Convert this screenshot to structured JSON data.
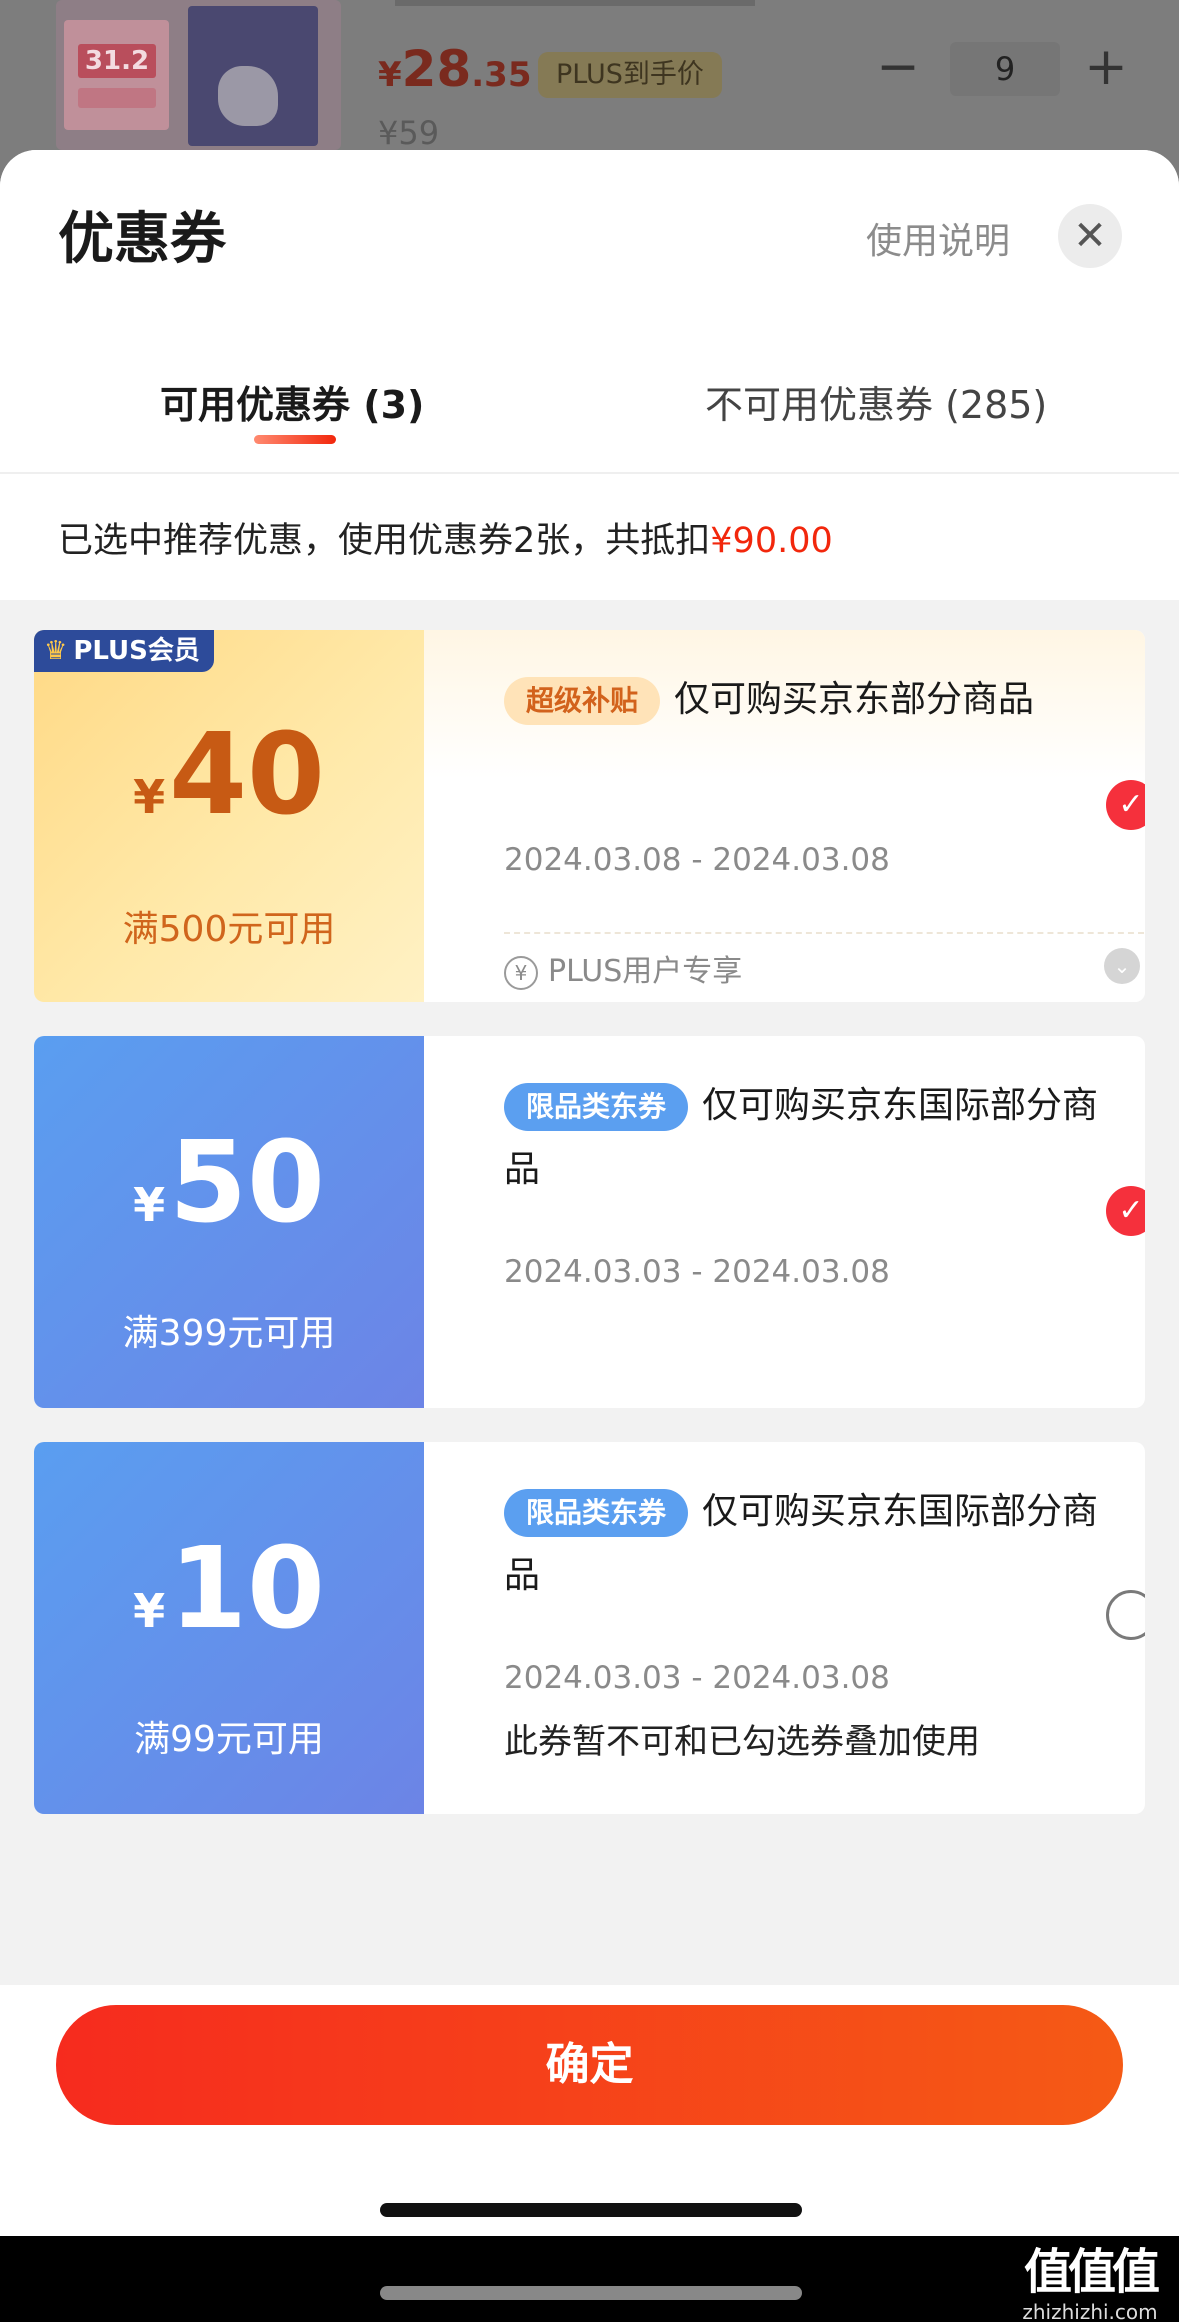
{
  "product": {
    "price_symbol": "¥",
    "price_int": "28",
    "price_dec": ".35",
    "plus_tag": "PLUS到手价",
    "original_price": "¥59",
    "quantity": "9",
    "minus": "−",
    "plus": "+",
    "image_badge": "31.2"
  },
  "sheet": {
    "title": "优惠券",
    "help_link": "使用说明",
    "close": "✕",
    "tabs": [
      {
        "label": "可用优惠券 (3)",
        "active": true
      },
      {
        "label": "不可用优惠券 (285)",
        "active": false
      }
    ],
    "summary_text": "已选中推荐优惠，使用优惠券2张，共抵扣",
    "summary_amount": "¥90.00"
  },
  "coupons": [
    {
      "badge": "PLUS会员",
      "crown": "♛",
      "currency": "¥",
      "value": "40",
      "threshold": "满500元可用",
      "tag": "超级补贴",
      "desc": "仅可购买京东部分商品",
      "date": "2024.03.08 - 2024.03.08",
      "footer_note": "PLUS用户专享",
      "yen_icon": "¥",
      "expand_icon": "⌄",
      "selected": true
    },
    {
      "currency": "¥",
      "value": "50",
      "threshold": "满399元可用",
      "tag": "限品类东券",
      "desc": "仅可购买京东国际部分商品",
      "date": "2024.03.03 - 2024.03.08",
      "selected": true
    },
    {
      "currency": "¥",
      "value": "10",
      "threshold": "满99元可用",
      "tag": "限品类东券",
      "desc": "仅可购买京东国际部分商品",
      "date": "2024.03.03 - 2024.03.08",
      "note": "此券暂不可和已勾选券叠加使用",
      "selected": false
    }
  ],
  "check_mark": "✓",
  "confirm_label": "确定",
  "watermark": {
    "logo": "值值值",
    "url": "zhizhizhi.com"
  },
  "colors": {
    "accent_red": "#f2270c",
    "check_red": "#f5303c",
    "blue_tag": "#5b9ff0",
    "gold_value": "#c75a14"
  }
}
